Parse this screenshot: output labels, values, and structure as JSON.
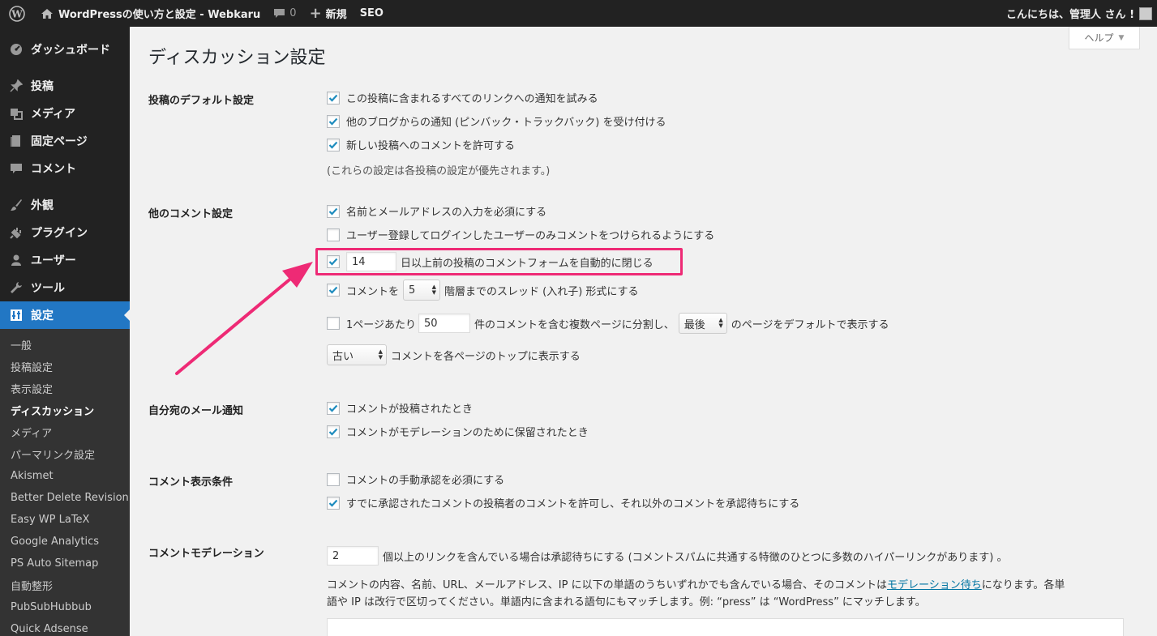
{
  "adminbar": {
    "site_title": "WordPressの使い方と設定 - Webkaru",
    "comments_count": "0",
    "new_label": "新規",
    "seo_label": "SEO",
    "greeting": "こんにちは、管理人 さん !"
  },
  "sidebar": {
    "items": [
      {
        "label": "ダッシュボード",
        "icon": "dashboard-icon"
      },
      {
        "label": "投稿",
        "icon": "pin-icon"
      },
      {
        "label": "メディア",
        "icon": "media-icon"
      },
      {
        "label": "固定ページ",
        "icon": "page-icon"
      },
      {
        "label": "コメント",
        "icon": "comment-icon"
      },
      {
        "label": "外観",
        "icon": "brush-icon"
      },
      {
        "label": "プラグイン",
        "icon": "plug-icon"
      },
      {
        "label": "ユーザー",
        "icon": "user-icon"
      },
      {
        "label": "ツール",
        "icon": "wrench-icon"
      },
      {
        "label": "設定",
        "icon": "settings-icon"
      }
    ],
    "submenu": [
      "一般",
      "投稿設定",
      "表示設定",
      "ディスカッション",
      "メディア",
      "パーマリンク設定",
      "Akismet",
      "Better Delete Revision",
      "Easy WP LaTeX",
      "Google Analytics",
      "PS Auto Sitemap",
      "自動整形",
      "PubSubHubbub",
      "Quick Adsense"
    ]
  },
  "help_label": "ヘルプ",
  "page_title": "ディスカッション設定",
  "sections": {
    "default": {
      "label": "投稿のデフォルト設定",
      "opt1": "この投稿に含まれるすべてのリンクへの通知を試みる",
      "opt2": "他のブログからの通知 (ピンバック・トラックバック) を受け付ける",
      "opt3": "新しい投稿へのコメントを許可する",
      "note": "(これらの設定は各投稿の設定が優先されます。)"
    },
    "other": {
      "label": "他のコメント設定",
      "opt1": "名前とメールアドレスの入力を必須にする",
      "opt2": "ユーザー登録してログインしたユーザーのみコメントをつけられるようにする",
      "close_days": "14",
      "close_text": "日以上前の投稿のコメントフォームを自動的に閉じる",
      "thread_prefix": "コメントを",
      "thread_depth": "5",
      "thread_suffix": "階層までのスレッド (入れ子) 形式にする",
      "page_prefix": "1ページあたり",
      "per_page": "50",
      "page_mid": "件のコメントを含む複数ページに分割し、",
      "page_default": "最後",
      "page_suffix": "のページをデフォルトで表示する",
      "order": "古い",
      "order_suffix": "コメントを各ページのトップに表示する"
    },
    "email": {
      "label": "自分宛のメール通知",
      "opt1": "コメントが投稿されたとき",
      "opt2": "コメントがモデレーションのために保留されたとき"
    },
    "appear": {
      "label": "コメント表示条件",
      "opt1": "コメントの手動承認を必須にする",
      "opt2": "すでに承認されたコメントの投稿者のコメントを許可し、それ以外のコメントを承認待ちにする"
    },
    "moderation": {
      "label": "コメントモデレーション",
      "links": "2",
      "links_text": "個以上のリンクを含んでいる場合は承認待ちにする (コメントスパムに共通する特徴のひとつに多数のハイパーリンクがあります) 。",
      "desc_a": "コメントの内容、名前、URL、メールアドレス、IP に以下の単語のうちいずれかでも含んでいる場合、そのコメントは",
      "desc_link": "モデレーション待ち",
      "desc_b": "になります。各単",
      "desc_c": "語や IP は改行で区切ってください。単語内に含まれる語句にもマッチします。例: “press” は “WordPress” にマッチします。"
    }
  },
  "colors": {
    "accent": "#2277c4",
    "highlight": "#ee2a75"
  }
}
